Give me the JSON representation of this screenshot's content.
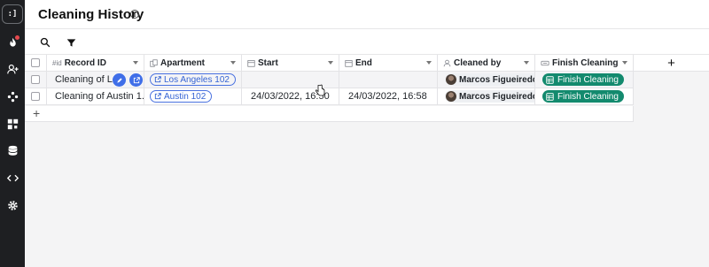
{
  "app": {
    "logo": ":]"
  },
  "rail": {
    "items": [
      "flame-icon",
      "user-plus-icon",
      "workflow-icon",
      "apps-icon",
      "database-icon",
      "code-icon",
      "settings-icon"
    ]
  },
  "header": {
    "title": "Cleaning History",
    "info_glyph": "i"
  },
  "toolbar": {
    "search": "search-icon",
    "filter": "filter-icon"
  },
  "table": {
    "columns": [
      {
        "type_prefix": "#id",
        "label": "Record ID"
      },
      {
        "type_prefix": "",
        "label": "Apartment"
      },
      {
        "type_prefix": "",
        "label": "Start"
      },
      {
        "type_prefix": "",
        "label": "End"
      },
      {
        "type_prefix": "",
        "label": "Cleaned by"
      },
      {
        "type_prefix": "",
        "label": "Finish Cleaning"
      }
    ],
    "add_column": "+",
    "add_row": "+",
    "rows": [
      {
        "record_id": "Cleaning of Los",
        "apartment": "Los Angeles 102",
        "start": "",
        "end": "",
        "cleaned_by": "Marcos Figueiredo",
        "action": "Finish Cleaning"
      },
      {
        "record_id": "Cleaning of Austin 1...",
        "apartment": "Austin 102",
        "start": "24/03/2022, 16:50",
        "end": "24/03/2022, 16:58",
        "cleaned_by": "Marcos Figueiredo",
        "action": "Finish Cleaning"
      }
    ]
  },
  "colors": {
    "accent": "#3f6ee8",
    "action": "#138a6e",
    "rail": "#1e1f22",
    "notification": "#e5484d"
  }
}
